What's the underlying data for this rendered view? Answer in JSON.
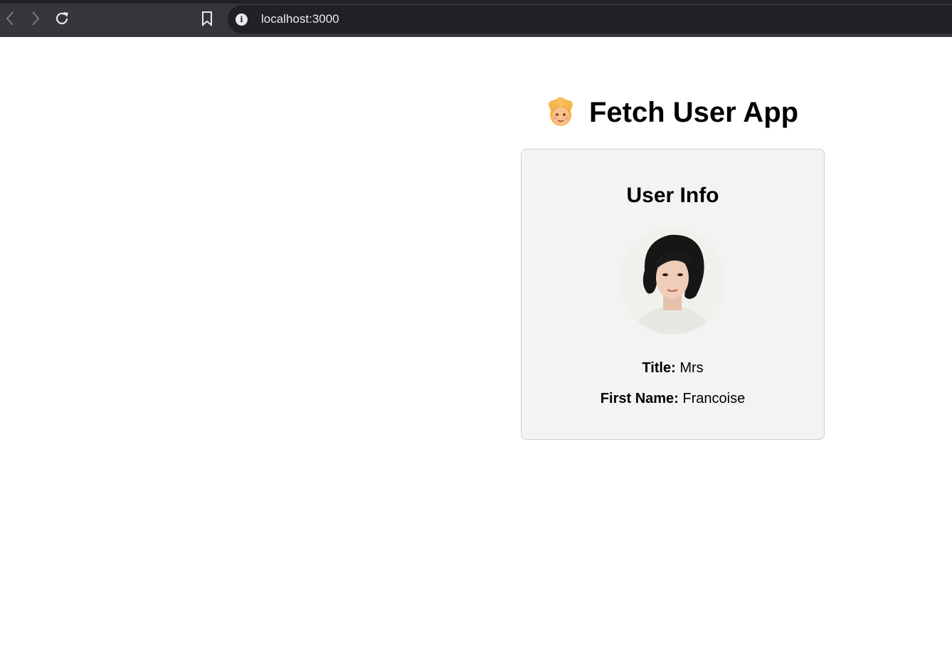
{
  "browser": {
    "url": "localhost:3000",
    "back_icon": "chevron-left-icon",
    "forward_icon": "chevron-right-icon",
    "reload_icon": "reload-icon",
    "bookmark_icon": "bookmark-icon",
    "site_info_icon": "info-icon",
    "site_info_glyph": "i"
  },
  "app": {
    "title_emoji": "🧑",
    "title": "Fetch User App"
  },
  "card": {
    "heading": "User Info",
    "fields": [
      {
        "label": "Title:",
        "value": "Mrs"
      },
      {
        "label": "First Name:",
        "value": "Francoise"
      }
    ]
  }
}
